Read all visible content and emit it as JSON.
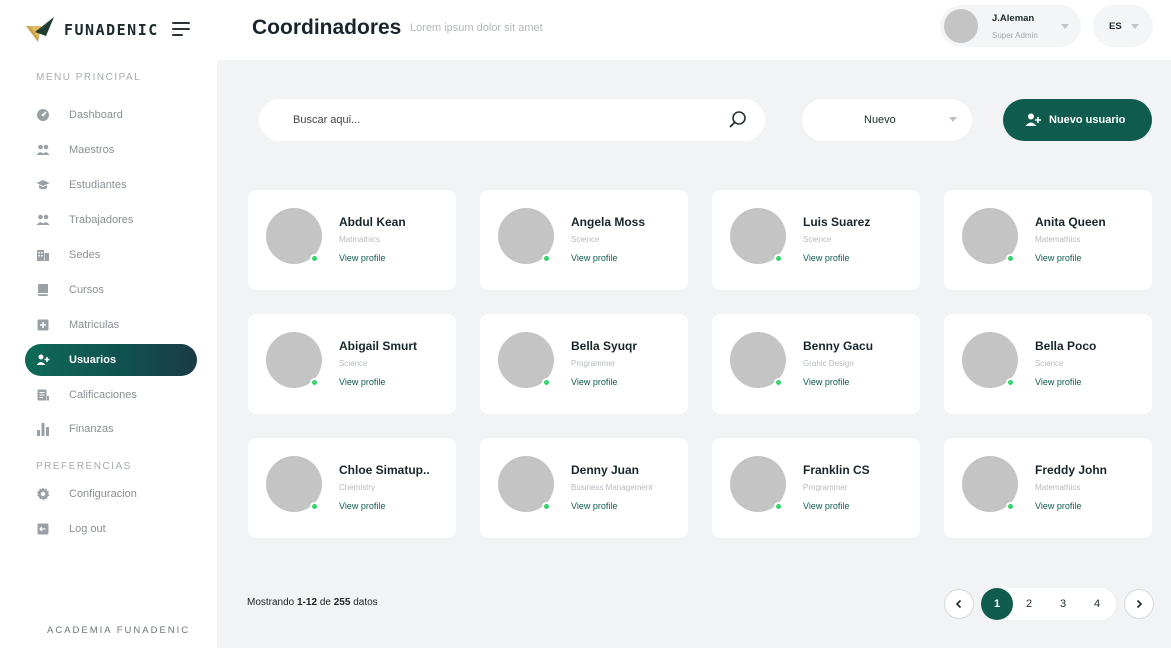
{
  "brand": {
    "name": "FUNADENIC",
    "footer": "ACADEMIA FUNADENIC"
  },
  "header": {
    "title": "Coordinadores",
    "subtitle": "Lorem ipsum  dolor sit amet",
    "user": {
      "name": "J.Aleman",
      "role": "Super Admin"
    },
    "language": "ES"
  },
  "sidebar": {
    "main_section": "MENU PRINCIPAL",
    "pref_section": "PREFERENCIAS",
    "items": [
      {
        "label": "Dashboard",
        "icon": "dashboard-icon"
      },
      {
        "label": "Maestros",
        "icon": "users-icon"
      },
      {
        "label": "Estudiantes",
        "icon": "graduation-cap-icon"
      },
      {
        "label": "Trabajadores",
        "icon": "users-icon"
      },
      {
        "label": "Sedes",
        "icon": "building-icon"
      },
      {
        "label": "Cursos",
        "icon": "book-icon"
      },
      {
        "label": "Matriculas",
        "icon": "plus-box-icon"
      },
      {
        "label": "Usuarios",
        "icon": "add-user-icon",
        "active": true
      },
      {
        "label": "Calificaciones",
        "icon": "grades-icon"
      },
      {
        "label": "Finanzas",
        "icon": "bar-chart-icon"
      }
    ],
    "pref_items": [
      {
        "label": "Configuracion",
        "icon": "gear-icon"
      },
      {
        "label": "Log out",
        "icon": "logout-icon"
      }
    ]
  },
  "toolbar": {
    "search_placeholder": "Buscar aqui...",
    "filter_label": "Nuevo",
    "new_button": "Nuevo usuario"
  },
  "cards": [
    {
      "name": "Abdul Kean",
      "subject": "Matmathics",
      "link": "View profile"
    },
    {
      "name": "Angela Moss",
      "subject": "Science",
      "link": "View profile"
    },
    {
      "name": "Luis Suarez",
      "subject": "Science",
      "link": "View profile"
    },
    {
      "name": "Anita Queen",
      "subject": "Matemathics",
      "link": "View profile"
    },
    {
      "name": "Abigail Smurt",
      "subject": "Science",
      "link": "View profile"
    },
    {
      "name": "Bella Syuqr",
      "subject": "Programmer",
      "link": "View profile"
    },
    {
      "name": "Benny Gacu",
      "subject": "Grahic Design",
      "link": "View profile"
    },
    {
      "name": "Bella Poco",
      "subject": "Science",
      "link": "View profile"
    },
    {
      "name": "Chloe Simatup..",
      "subject": "Chemistry",
      "link": "View profile"
    },
    {
      "name": "Denny Juan",
      "subject": "Business Management",
      "link": "View profile"
    },
    {
      "name": "Franklin CS",
      "subject": "Programmer",
      "link": "View profile"
    },
    {
      "name": "Freddy John",
      "subject": "Matemathics",
      "link": "View profile"
    }
  ],
  "footer": {
    "showing_prefix": "Mostrando ",
    "range": "1-12",
    "de": " de ",
    "total": "255",
    "suffix": " datos"
  },
  "pagination": {
    "pages": [
      "1",
      "2",
      "3",
      "4"
    ],
    "current": "1"
  },
  "colors": {
    "primary": "#0f5c4f",
    "online": "#3ad26a",
    "avatar": "#c4c4c4",
    "background": "#f2f3f5"
  }
}
